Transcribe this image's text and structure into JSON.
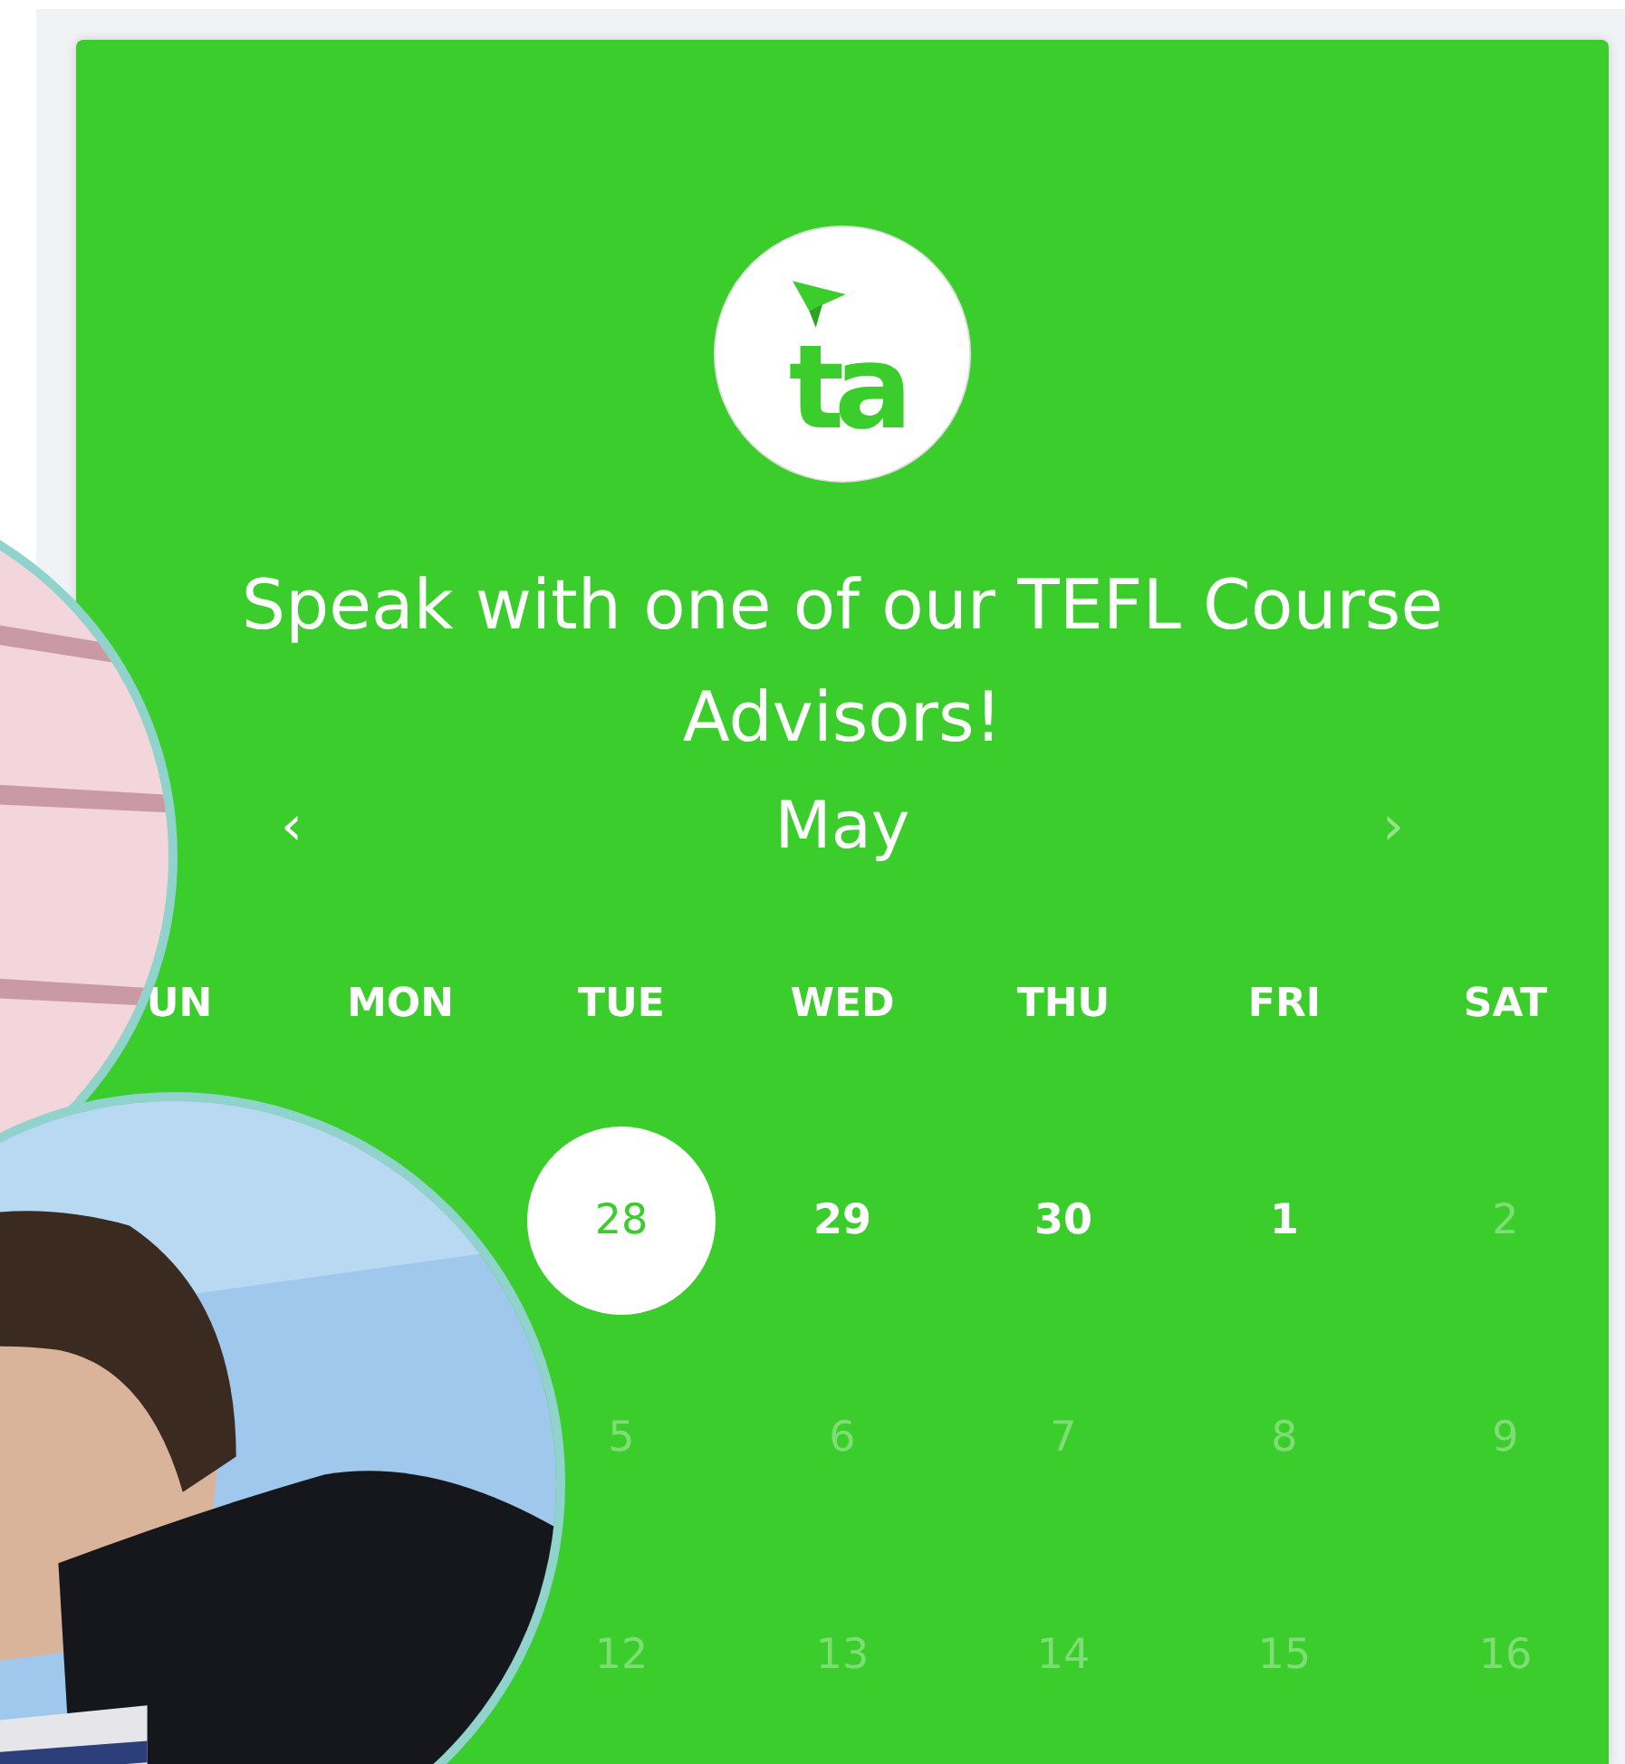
{
  "logo": {
    "text": "ta"
  },
  "title": "Speak with one of our TEFL Course Advisors!",
  "calendar": {
    "prev": "‹",
    "month": "May",
    "next": "›",
    "prev_disabled": false,
    "next_disabled": true,
    "weekdays": [
      "UN",
      "MON",
      "TUE",
      "WED",
      "THU",
      "FRI",
      "SAT"
    ],
    "weeks": [
      {
        "days": [
          {
            "label": "28",
            "selected": true,
            "available": true
          },
          {
            "label": "29",
            "selected": false,
            "available": true
          },
          {
            "label": "30",
            "selected": false,
            "available": true
          },
          {
            "label": "1",
            "selected": false,
            "available": true
          },
          {
            "label": "2",
            "selected": false,
            "available": false
          }
        ]
      },
      {
        "days": [
          {
            "label": "5",
            "selected": false,
            "available": false
          },
          {
            "label": "6",
            "selected": false,
            "available": false
          },
          {
            "label": "7",
            "selected": false,
            "available": false
          },
          {
            "label": "8",
            "selected": false,
            "available": false
          },
          {
            "label": "9",
            "selected": false,
            "available": false
          }
        ]
      },
      {
        "days": [
          {
            "label": "12",
            "selected": false,
            "available": false
          },
          {
            "label": "13",
            "selected": false,
            "available": false
          },
          {
            "label": "14",
            "selected": false,
            "available": false
          },
          {
            "label": "15",
            "selected": false,
            "available": false
          },
          {
            "label": "16",
            "selected": false,
            "available": false
          }
        ]
      }
    ]
  }
}
